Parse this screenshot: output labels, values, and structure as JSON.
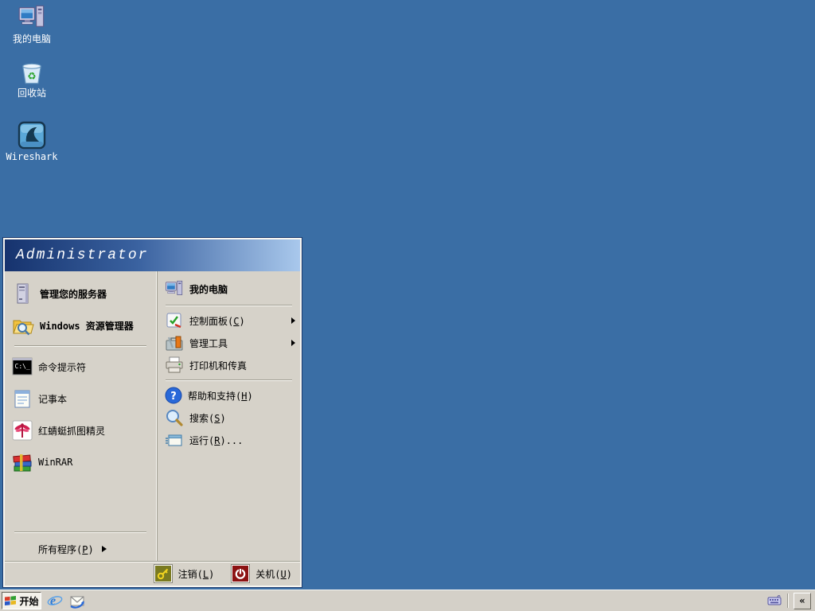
{
  "desktop": {
    "icons": [
      {
        "label": "我的电脑"
      },
      {
        "label": "回收站"
      },
      {
        "label": "Wireshark"
      }
    ]
  },
  "start_menu": {
    "user_name": "Administrator",
    "pinned": [
      {
        "label": "管理您的服务器"
      },
      {
        "label": "Windows 资源管理器"
      }
    ],
    "recent": [
      {
        "label": "命令提示符"
      },
      {
        "label": "记事本"
      },
      {
        "label": "红蜻蜓抓图精灵"
      },
      {
        "label": "WinRAR"
      }
    ],
    "all_programs": {
      "pre": "所有程序(",
      "key": "P",
      "post": ")"
    },
    "right": [
      {
        "pre": "我的电脑",
        "key": "",
        "post": ""
      },
      {
        "pre": "控制面板(",
        "key": "C",
        "post": ")"
      },
      {
        "pre": "管理工具",
        "key": "",
        "post": ""
      },
      {
        "pre": "打印机和传真",
        "key": "",
        "post": ""
      },
      {
        "pre": "帮助和支持(",
        "key": "H",
        "post": ")"
      },
      {
        "pre": "搜索(",
        "key": "S",
        "post": ")"
      },
      {
        "pre": "运行(",
        "key": "R",
        "post": ")..."
      }
    ],
    "logoff": {
      "pre": "注销(",
      "key": "L",
      "post": ")"
    },
    "shutdown": {
      "pre": "关机(",
      "key": "U",
      "post": ")"
    }
  },
  "taskbar": {
    "start_label": "开始",
    "tray_collapse": "«"
  },
  "icon_glyphs": {
    "cmd_text": "C:\\_",
    "help_glyph": "?",
    "ie_glyph": "e",
    "recycle_glyph": "♻"
  },
  "colors": {
    "desktop_background": "#3A6EA5",
    "menu_face": "#D6D2C9",
    "banner_dark": "#16336E",
    "banner_light": "#A9C8EC",
    "taskbar": "#D4D0C8",
    "logoff_chip": "#7A7A20",
    "shutdown_chip": "#8C1212"
  }
}
